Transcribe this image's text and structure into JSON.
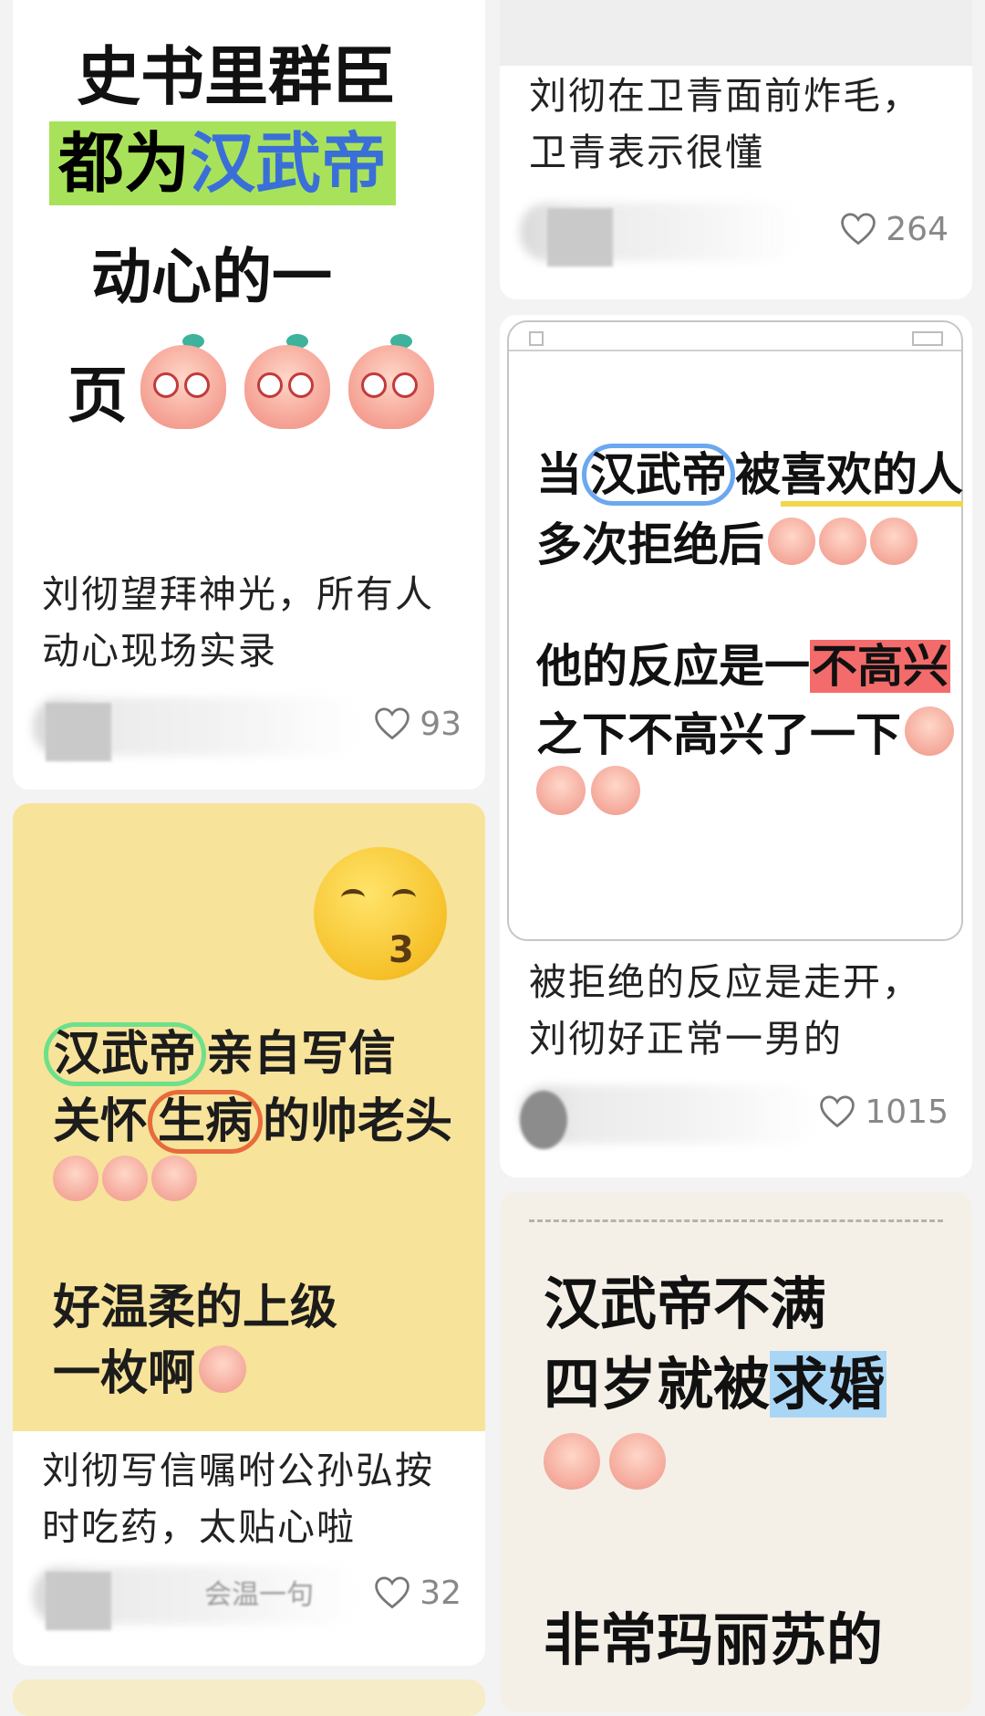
{
  "left_column": {
    "cards": [
      {
        "poster_lines": [
          "史书里群臣",
          "都为",
          "汉武帝",
          "动心的一",
          "页"
        ],
        "caption": "刘彻望拜神光，所有人动心现场实录",
        "caption_l1": "刘彻望拜神光，所有人",
        "caption_l2": "动心现场实录",
        "likes": "93"
      },
      {
        "poster_line1a": "汉武帝",
        "poster_line1b": "亲自写信",
        "poster_line2a": "关怀",
        "poster_line2b": "生病",
        "poster_line2c": "的帅老头",
        "poster_line3": "好温柔的上级",
        "poster_line4": "一枚啊",
        "caption_l1": "刘彻写信嘱咐公孙弘按",
        "caption_l2": "时吃药，太贴心啦",
        "meta_snippet": "会温一句",
        "likes": "32"
      }
    ]
  },
  "right_column": {
    "cards": [
      {
        "caption_l1": "刘彻在卫青面前炸毛，",
        "caption_l2": "卫青表示很懂",
        "likes": "264"
      },
      {
        "poster_line1a": "当",
        "poster_line1b": "汉武帝",
        "poster_line1c": "被",
        "poster_line1d": "喜欢的人",
        "poster_line2": "多次拒绝后",
        "poster_line3a": "他的反应是一",
        "poster_line3b": "不高兴",
        "poster_line4": "之下不高兴了一下",
        "caption_l1": "被拒绝的反应是走开，",
        "caption_l2": "刘彻好正常一男的",
        "likes": "1015"
      },
      {
        "poster_line1": "汉武帝不满",
        "poster_line2a": "四岁就被",
        "poster_line2b": "求婚",
        "poster_line3": "非常玛丽苏的"
      }
    ]
  },
  "colors": {
    "page_bg": "#f3f3f3",
    "card_bg": "#ffffff",
    "poster2_bg": "#f7e39a",
    "poster5_bg": "#f4f0e8",
    "highlight_green": "#a8e25a",
    "text_blue": "#3a6fd8",
    "highlight_red": "#f46b6b",
    "highlight_blue": "#a9d6f5",
    "like_grey": "#888888"
  },
  "icons": [
    "heart-outline-icon",
    "kiss-emoji-icon",
    "peach-sticker-icon"
  ]
}
